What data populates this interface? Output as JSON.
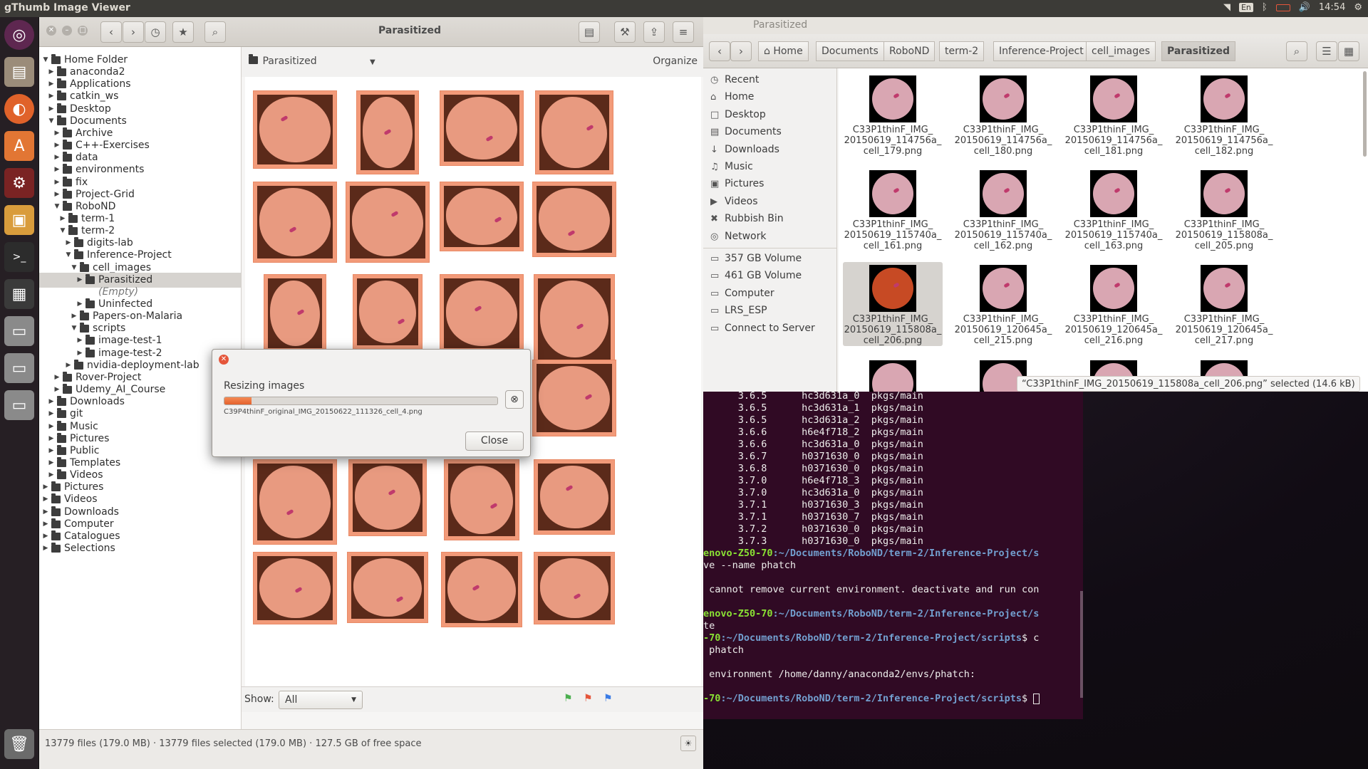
{
  "topbar": {
    "app_title": "gThumb Image Viewer",
    "lang": "En",
    "volume_icon": "volume-icon",
    "clock": "14:54"
  },
  "launcher": {
    "items": [
      "ubuntu-logo-icon",
      "files-icon",
      "firefox-icon",
      "software-center-icon",
      "settings-icon",
      "image-viewer-icon",
      "terminal-icon",
      "workspace-icon",
      "drive-icon",
      "drive-icon",
      "drive-icon",
      "trash-icon"
    ]
  },
  "gthumb": {
    "title": "Parasitized",
    "location": "Parasitized",
    "organize": "Organize",
    "tree": [
      {
        "label": "Home Folder",
        "level": 0,
        "expanded": true
      },
      {
        "label": "anaconda2",
        "level": 1
      },
      {
        "label": "Applications",
        "level": 1
      },
      {
        "label": "catkin_ws",
        "level": 1
      },
      {
        "label": "Desktop",
        "level": 1
      },
      {
        "label": "Documents",
        "level": 1,
        "expanded": true
      },
      {
        "label": "Archive",
        "level": 2
      },
      {
        "label": "C++-Exercises",
        "level": 2
      },
      {
        "label": "data",
        "level": 2
      },
      {
        "label": "environments",
        "level": 2
      },
      {
        "label": "fix",
        "level": 2
      },
      {
        "label": "Project-Grid",
        "level": 2
      },
      {
        "label": "RoboND",
        "level": 2,
        "expanded": true
      },
      {
        "label": "term-1",
        "level": 3
      },
      {
        "label": "term-2",
        "level": 3,
        "expanded": true
      },
      {
        "label": "digits-lab",
        "level": 4
      },
      {
        "label": "Inference-Project",
        "level": 4,
        "expanded": true
      },
      {
        "label": "cell_images",
        "level": 5,
        "expanded": true
      },
      {
        "label": "Parasitized",
        "level": 6,
        "selected": true
      },
      {
        "label": "(Empty)",
        "level": 7,
        "italic": true
      },
      {
        "label": "Uninfected",
        "level": 6
      },
      {
        "label": "Papers-on-Malaria",
        "level": 5
      },
      {
        "label": "scripts",
        "level": 5,
        "expanded": true
      },
      {
        "label": "image-test-1",
        "level": 6
      },
      {
        "label": "image-test-2",
        "level": 6
      },
      {
        "label": "nvidia-deployment-lab",
        "level": 4
      },
      {
        "label": "Rover-Project",
        "level": 2
      },
      {
        "label": "Udemy_AI_Course",
        "level": 2
      },
      {
        "label": "Downloads",
        "level": 1
      },
      {
        "label": "git",
        "level": 1
      },
      {
        "label": "Music",
        "level": 1
      },
      {
        "label": "Pictures",
        "level": 1
      },
      {
        "label": "Public",
        "level": 1
      },
      {
        "label": "Templates",
        "level": 1
      },
      {
        "label": "Videos",
        "level": 1
      },
      {
        "label": "Pictures",
        "level": 0
      },
      {
        "label": "Videos",
        "level": 0
      },
      {
        "label": "Downloads",
        "level": 0
      },
      {
        "label": "Computer",
        "level": 0
      },
      {
        "label": "Catalogues",
        "level": 0
      },
      {
        "label": "Selections",
        "level": 0
      }
    ],
    "show_label": "Show:",
    "show_value": "All",
    "status": "13779 files (179.0 MB)  ·  13779 files selected (179.0 MB)  ·  127.5 GB of free space"
  },
  "dialog": {
    "title": "Resizing images",
    "progress": 0.1,
    "file": "C39P4thinF_original_IMG_20150622_111326_cell_4.png",
    "close_label": "Close"
  },
  "nautilus": {
    "title": "Parasitized",
    "breadcrumbs": [
      "Home",
      "Documents",
      "RoboND",
      "term-2",
      "Inference-Project",
      "cell_images",
      "Parasitized"
    ],
    "sidebar": [
      "Recent",
      "Home",
      "Desktop",
      "Documents",
      "Downloads",
      "Music",
      "Pictures",
      "Videos",
      "Rubbish Bin",
      "Network",
      "357 GB Volume",
      "461 GB Volume",
      "Computer",
      "LRS_ESP",
      "Connect to Server"
    ],
    "files": [
      [
        "C33P1thinF_IMG_",
        "20150619_114756a_",
        "cell_179.png"
      ],
      [
        "C33P1thinF_IMG_",
        "20150619_114756a_",
        "cell_180.png"
      ],
      [
        "C33P1thinF_IMG_",
        "20150619_114756a_",
        "cell_181.png"
      ],
      [
        "C33P1thinF_IMG_",
        "20150619_114756a_",
        "cell_182.png"
      ],
      [
        "C33P1thinF_IMG_",
        "20150619_115740a_",
        "cell_161.png"
      ],
      [
        "C33P1thinF_IMG_",
        "20150619_115740a_",
        "cell_162.png"
      ],
      [
        "C33P1thinF_IMG_",
        "20150619_115740a_",
        "cell_163.png"
      ],
      [
        "C33P1thinF_IMG_",
        "20150619_115808a_",
        "cell_205.png"
      ],
      [
        "C33P1thinF_IMG_",
        "20150619_115808a_",
        "cell_206.png"
      ],
      [
        "C33P1thinF_IMG_",
        "20150619_120645a_",
        "cell_215.png"
      ],
      [
        "C33P1thinF_IMG_",
        "20150619_120645a_",
        "cell_216.png"
      ],
      [
        "C33P1thinF_IMG_",
        "20150619_120645a_",
        "cell_217.png"
      ]
    ],
    "status": "“C33P1thinF_IMG_20150619_115808a_cell_206.png” selected  (14.6 kB)"
  },
  "terminal": {
    "lines": [
      "      3.6.5      hc3d631a_0  pkgs/main",
      "      3.6.5      hc3d631a_1  pkgs/main",
      "      3.6.5      hc3d631a_2  pkgs/main",
      "      3.6.6      h6e4f718_2  pkgs/main",
      "      3.6.6      hc3d631a_0  pkgs/main",
      "      3.6.7      h0371630_0  pkgs/main",
      "      3.6.8      h0371630_0  pkgs/main",
      "      3.7.0      h6e4f718_3  pkgs/main",
      "      3.7.0      hc3d631a_0  pkgs/main",
      "      3.7.1      h0371630_3  pkgs/main",
      "      3.7.1      h0371630_7  pkgs/main",
      "      3.7.2      h0371630_0  pkgs/main",
      "      3.7.3      h0371630_0  pkgs/main"
    ],
    "prompt1_host": "enovo-Z50-70",
    "prompt1_path": ":~/Documents/RoboND/term-2/Inference-Project/s",
    "cmd1": "ve --name phatch",
    "blank": "",
    "error": " cannot remove current environment. deactivate and run con",
    "prompt2_host": "enovo-Z50-70",
    "prompt2_path": ":~/Documents/RoboND/term-2/Inference-Project/s",
    "cmd2": "te",
    "prompt3_host": "-70",
    "prompt3_path": ":~/Documents/RoboND/term-2/Inference-Project/scripts",
    "cmd3": "$ c",
    "cmd3b": " phatch",
    "env_line": " environment /home/danny/anaconda2/envs/phatch:",
    "prompt4_host": "-70",
    "prompt4_path": ":~/Documents/RoboND/term-2/Inference-Project/scripts",
    "cmd4": "$ "
  }
}
